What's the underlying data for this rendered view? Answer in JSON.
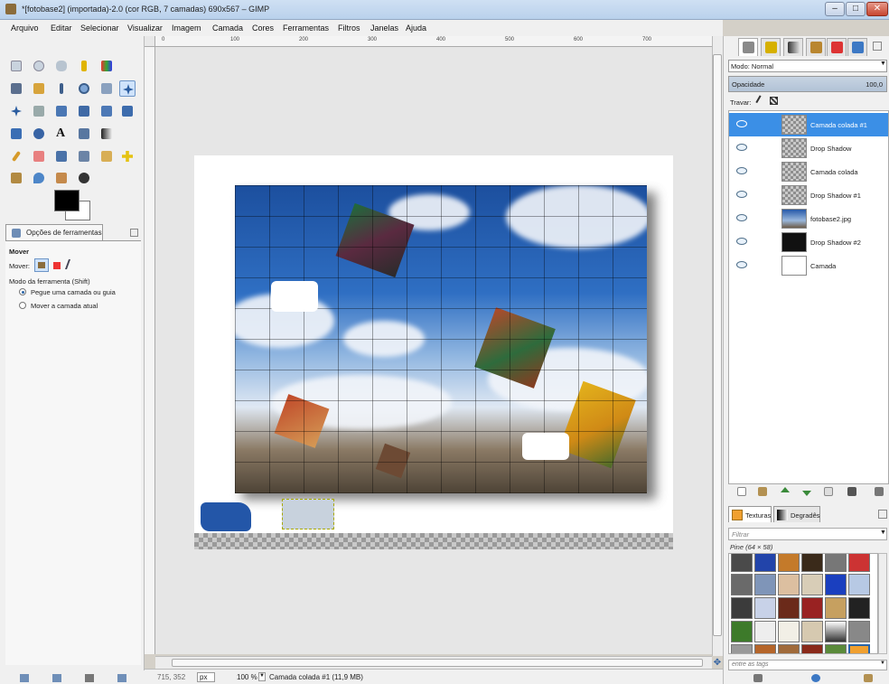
{
  "window": {
    "title": "*[fotobase2] (importada)-2.0 (cor RGB, 7 camadas) 690x567 – GIMP"
  },
  "menu": [
    "Arquivo",
    "Editar",
    "Selecionar",
    "Visualizar",
    "Imagem",
    "Camada",
    "Cores",
    "Ferramentas",
    "Filtros",
    "Janelas",
    "Ajuda"
  ],
  "rulers": [
    "0",
    "100",
    "200",
    "300",
    "400",
    "500",
    "600",
    "700"
  ],
  "tool_options": {
    "tab_label": "Opções de ferramentas",
    "tool_name": "Mover",
    "move_label": "Mover:",
    "mode_label": "Modo da ferramenta (Shift)",
    "option1": "Pegue uma camada ou guia",
    "option2": "Mover a camada atual"
  },
  "colors": {
    "foreground": "#000000",
    "background": "#ffffff",
    "selection": "#3b8fe6"
  },
  "layers_panel": {
    "mode_label": "Modo: Normal",
    "opacity_label": "Opacidade",
    "opacity_value": "100,0",
    "lock_label": "Travar:",
    "layers": [
      {
        "name": "Camada colada #1",
        "selected": true
      },
      {
        "name": "Drop Shadow",
        "selected": false
      },
      {
        "name": "Camada colada",
        "selected": false
      },
      {
        "name": "Drop Shadow #1",
        "selected": false
      },
      {
        "name": "fotobase2.jpg",
        "selected": false
      },
      {
        "name": "Drop Shadow #2",
        "selected": false
      },
      {
        "name": "Camada",
        "selected": false
      }
    ]
  },
  "patterns_panel": {
    "tab1": "Texturas",
    "tab2": "Degradês",
    "filter_placeholder": "Filtrar",
    "pattern_name": "Pine (64 × 58)",
    "tags_placeholder": "entre as tags"
  },
  "status": {
    "coords": "715, 352",
    "unit": "px",
    "zoom": "100 %",
    "message": "Camada colada #1 (11,9 MB)"
  }
}
